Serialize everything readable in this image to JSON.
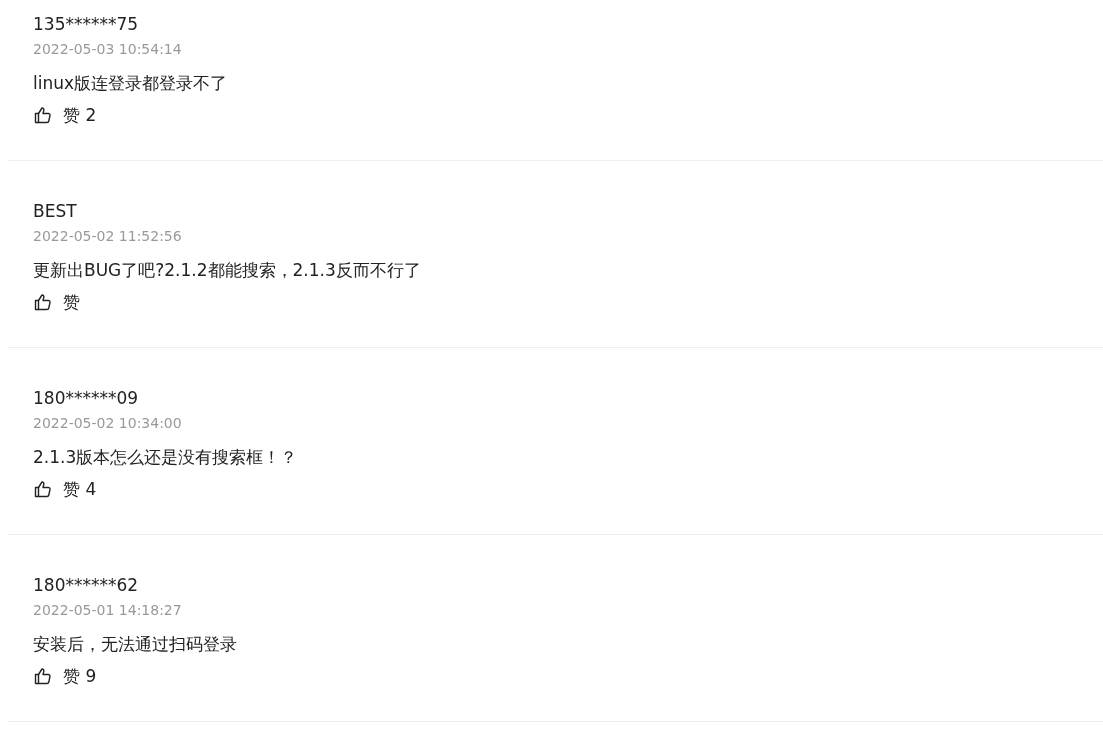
{
  "comments": [
    {
      "user": "135******75",
      "time": "2022-05-03 10:54:14",
      "text": "linux版连登录都登录不了",
      "like_label": "赞",
      "likes": "2"
    },
    {
      "user": "BEST",
      "time": "2022-05-02 11:52:56",
      "text": "更新出BUG了吧?2.1.2都能搜索，2.1.3反而不行了",
      "like_label": "赞"
    },
    {
      "user": "180******09",
      "time": "2022-05-02 10:34:00",
      "text": "2.1.3版本怎么还是没有搜索框！？",
      "like_label": "赞",
      "likes": "4"
    },
    {
      "user": "180******62",
      "time": "2022-05-01 14:18:27",
      "text": "安装后，无法通过扫码登录",
      "like_label": "赞",
      "likes": "9"
    }
  ]
}
